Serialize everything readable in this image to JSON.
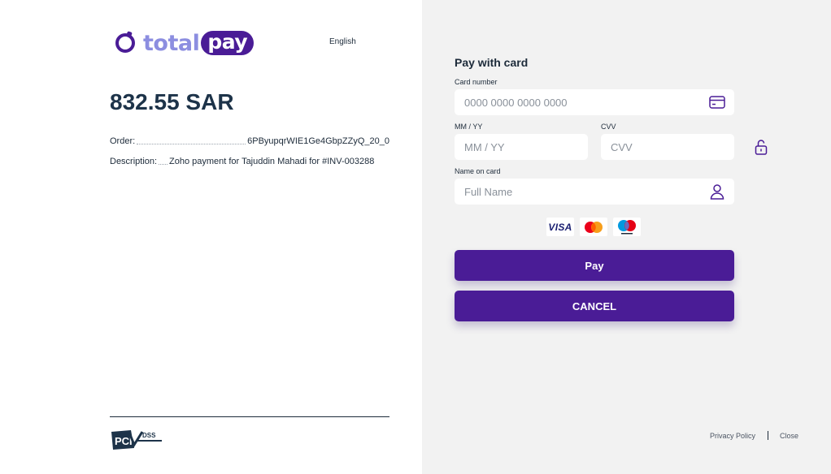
{
  "brand": {
    "total": "total",
    "pay": "pay"
  },
  "language": "English",
  "amount": "832.55 SAR",
  "order": {
    "label": "Order:",
    "value": "6PByupqrWIE1Ge4GbpZZyQ_20_0"
  },
  "description": {
    "label": "Description:",
    "value": "Zoho payment for Tajuddin Mahadi for #INV-003288"
  },
  "footer": {
    "pci_text": "PCI",
    "dss_text": "DSS",
    "privacy": "Privacy Policy",
    "close": "Close"
  },
  "form": {
    "title": "Pay with card",
    "card_number": {
      "label": "Card number",
      "placeholder": "0000 0000 0000 0000"
    },
    "expiry": {
      "label": "MM / YY",
      "placeholder": "MM / YY"
    },
    "cvv": {
      "label": "CVV",
      "placeholder": "CVV"
    },
    "name": {
      "label": "Name on card",
      "placeholder": "Full Name"
    },
    "card_brands": {
      "visa": "VISA"
    },
    "pay_label": "Pay",
    "cancel_label": "CANCEL"
  },
  "colors": {
    "primary": "#4a1c96",
    "logo_light": "#8c8ee0",
    "panel_bg": "#f2f2f2"
  }
}
